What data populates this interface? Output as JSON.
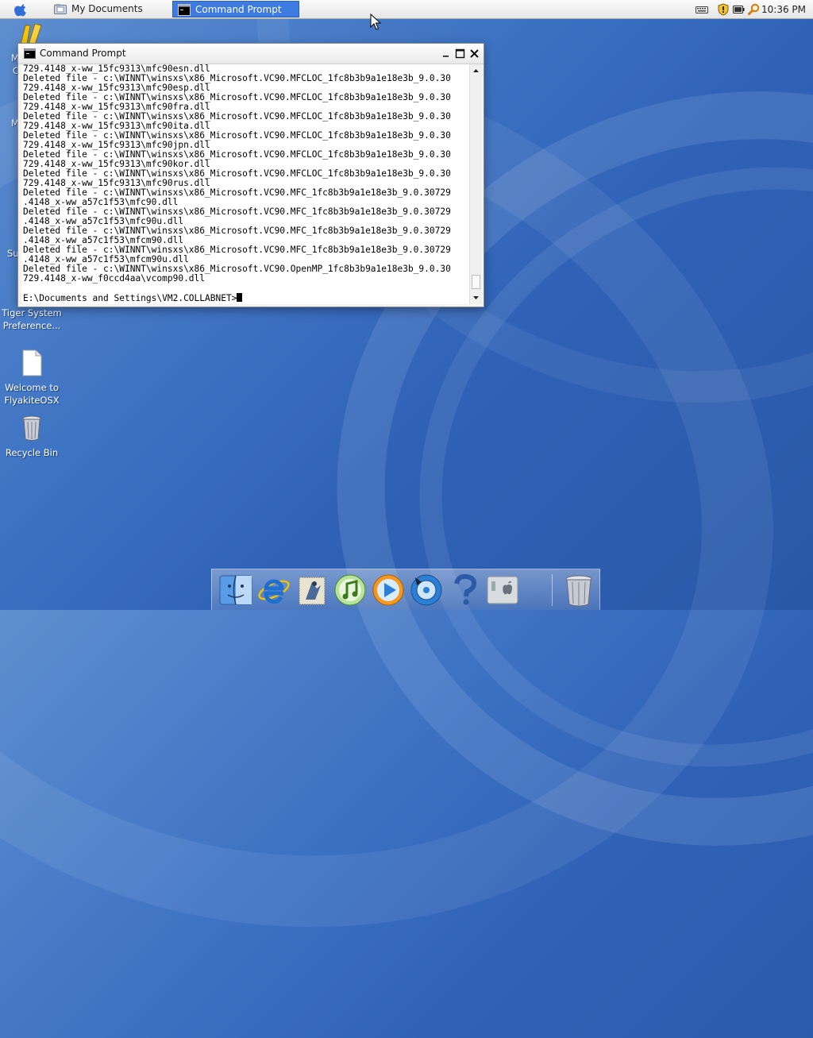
{
  "menubar": {
    "tasks": [
      {
        "label": "My Documents",
        "icon": "folder-icon"
      },
      {
        "label": "Command Prompt",
        "icon": "console-icon",
        "active": true
      }
    ],
    "tray_icons": [
      "keyboard-icon",
      "security-shield-icon",
      "battery-icon",
      "search-icon"
    ],
    "clock": "10:36 PM"
  },
  "desktop": {
    "icons": [
      {
        "label": "Tiger System Preference...",
        "icon": "system-preferences-icon"
      },
      {
        "label": "Welcome to FlyakiteOSX",
        "icon": "document-icon"
      },
      {
        "label": "Recycle Bin",
        "icon": "trash-icon"
      }
    ],
    "partial_labels": [
      "M",
      "C",
      "M",
      "Su"
    ]
  },
  "cmd_window": {
    "title": "Command Prompt",
    "lines": [
      "729.4148_x-ww_15fc9313\\mfc90esn.dll",
      "Deleted file - c:\\WINNT\\winsxs\\x86_Microsoft.VC90.MFCLOC_1fc8b3b9a1e18e3b_9.0.30",
      "729.4148_x-ww_15fc9313\\mfc90esp.dll",
      "Deleted file - c:\\WINNT\\winsxs\\x86_Microsoft.VC90.MFCLOC_1fc8b3b9a1e18e3b_9.0.30",
      "729.4148_x-ww_15fc9313\\mfc90fra.dll",
      "Deleted file - c:\\WINNT\\winsxs\\x86_Microsoft.VC90.MFCLOC_1fc8b3b9a1e18e3b_9.0.30",
      "729.4148_x-ww_15fc9313\\mfc90ita.dll",
      "Deleted file - c:\\WINNT\\winsxs\\x86_Microsoft.VC90.MFCLOC_1fc8b3b9a1e18e3b_9.0.30",
      "729.4148_x-ww_15fc9313\\mfc90jpn.dll",
      "Deleted file - c:\\WINNT\\winsxs\\x86_Microsoft.VC90.MFCLOC_1fc8b3b9a1e18e3b_9.0.30",
      "729.4148_x-ww_15fc9313\\mfc90kor.dll",
      "Deleted file - c:\\WINNT\\winsxs\\x86_Microsoft.VC90.MFCLOC_1fc8b3b9a1e18e3b_9.0.30",
      "729.4148_x-ww_15fc9313\\mfc90rus.dll",
      "Deleted file - c:\\WINNT\\winsxs\\x86_Microsoft.VC90.MFC_1fc8b3b9a1e18e3b_9.0.30729",
      ".4148_x-ww_a57c1f53\\mfc90.dll",
      "Deleted file - c:\\WINNT\\winsxs\\x86_Microsoft.VC90.MFC_1fc8b3b9a1e18e3b_9.0.30729",
      ".4148_x-ww_a57c1f53\\mfc90u.dll",
      "Deleted file - c:\\WINNT\\winsxs\\x86_Microsoft.VC90.MFC_1fc8b3b9a1e18e3b_9.0.30729",
      ".4148_x-ww_a57c1f53\\mfcm90.dll",
      "Deleted file - c:\\WINNT\\winsxs\\x86_Microsoft.VC90.MFC_1fc8b3b9a1e18e3b_9.0.30729",
      ".4148_x-ww_a57c1f53\\mfcm90u.dll",
      "Deleted file - c:\\WINNT\\winsxs\\x86_Microsoft.VC90.OpenMP_1fc8b3b9a1e18e3b_9.0.30",
      "729.4148_x-ww_f0ccd4aa\\vcomp90.dll",
      "",
      "E:\\Documents and Settings\\VM2.COLLABNET>"
    ]
  },
  "dock": {
    "items": [
      "finder-icon",
      "internet-explorer-icon",
      "mail-icon",
      "itunes-icon",
      "media-player-icon",
      "dvd-player-icon",
      "help-icon",
      "system-preferences-icon",
      "trash-icon"
    ]
  }
}
